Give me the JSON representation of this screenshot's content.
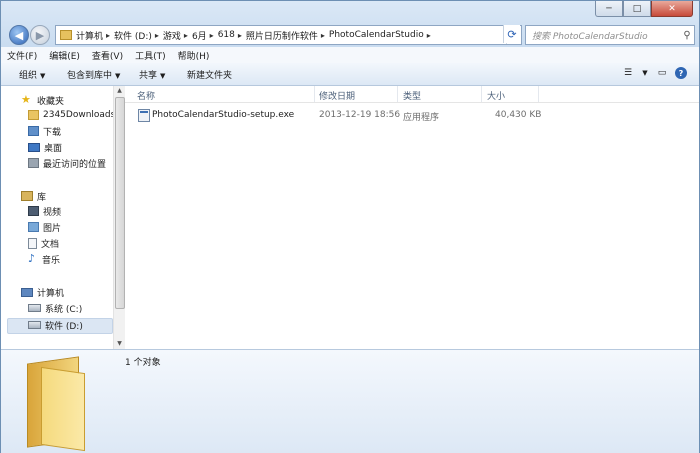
{
  "window": {
    "minimize_glyph": "─",
    "maximize_glyph": "□",
    "close_glyph": "✕"
  },
  "address": {
    "crumbs": [
      "计算机",
      "软件 (D:)",
      "游戏",
      "6月",
      "618",
      "照片日历制作软件",
      "PhotoCalendarStudio"
    ],
    "separator": "▸"
  },
  "search": {
    "placeholder": "搜索 PhotoCalendarStudio"
  },
  "menu": [
    "文件(F)",
    "编辑(E)",
    "查看(V)",
    "工具(T)",
    "帮助(H)"
  ],
  "toolbar": {
    "organize": "组织",
    "include_in_library": "包含到库中",
    "share": "共享",
    "new_folder": "新建文件夹",
    "help_glyph": "?"
  },
  "nav": {
    "favorites": "收藏夹",
    "fav_items": [
      "2345Downloads",
      "下载",
      "桌面",
      "最近访问的位置"
    ],
    "libraries": "库",
    "lib_items": [
      "视频",
      "图片",
      "文档",
      "音乐"
    ],
    "computer": "计算机",
    "drives": [
      "系统 (C:)",
      "软件 (D:)"
    ]
  },
  "columns": {
    "name": "名称",
    "modified": "修改日期",
    "type": "类型",
    "size": "大小"
  },
  "files": [
    {
      "name": "PhotoCalendarStudio-setup.exe",
      "modified": "2013-12-19 18:56",
      "type": "应用程序",
      "size": "40,430 KB"
    }
  ],
  "status": {
    "count": "1 个对象"
  },
  "colors": {
    "chrome": "#dbe8f6",
    "border": "#6d8fb3",
    "accent": "#2d63b5",
    "close": "#c74a3a"
  },
  "icons": {
    "back": "back-arrow-icon",
    "forward": "forward-arrow-icon",
    "refresh": "refresh-icon",
    "search": "search-icon",
    "exe": "application-icon",
    "folder": "folder-icon"
  }
}
